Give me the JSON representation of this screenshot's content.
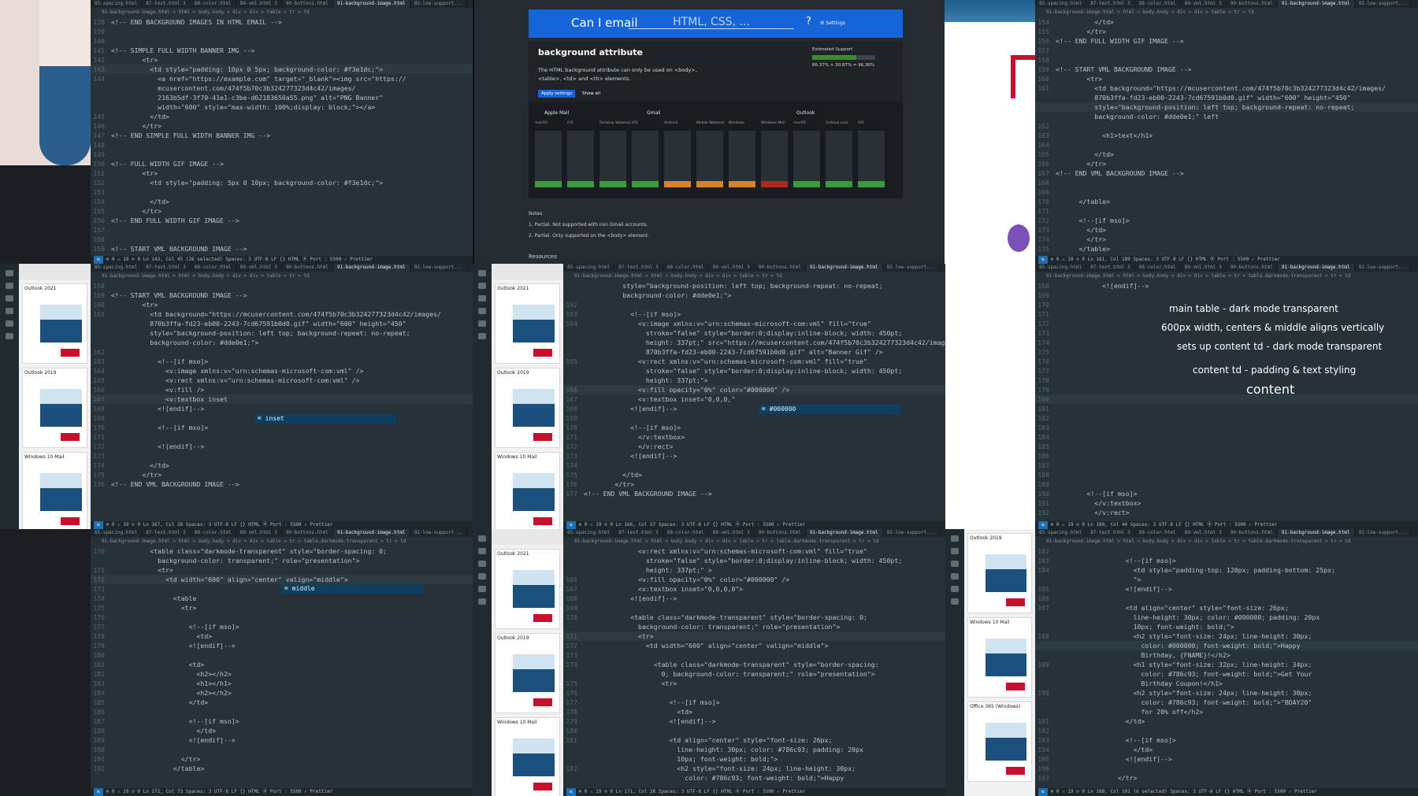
{
  "tabs": [
    "85-spacing.html",
    "87-text.html 3",
    "88-color.html",
    "89-vml.html 3",
    "90-buttons.html",
    "91-background-image.html",
    "92-low-support..."
  ],
  "crumb": "91-background-image.html > html > body.body > div > div > table > tr > td",
  "crumb_dark": "91-background-image.html > html > body.body > div > div > table > tr > table.darkmode-transparent > tr > td",
  "status_common": "⊗ 0 ⚠ 19   ⊘ 0",
  "status_right": "Spaces: 3   UTF-8   LF   {} HTML   ⦿ Port : 5500   ✓ Prettier",
  "pane1": {
    "lines": [
      {
        "n": "138",
        "t": "<!-- END BACKGROUND IMAGES IN HTML EMAIL -->"
      },
      {
        "n": "139",
        "t": ""
      },
      {
        "n": "140",
        "t": ""
      },
      {
        "n": "141",
        "t": "<!-- SIMPLE FULL WIDTH BANNER IMG -->"
      },
      {
        "n": "142",
        "t": "        <tr>"
      },
      {
        "n": "143",
        "t": "          <td style=\"padding: 10px 0 5px; background-color: #f3e1dc;\">",
        "hl": true
      },
      {
        "n": "144",
        "t": "            <a href=\"https://example.com\" target=\"_blank\"><img src=\"https://"
      },
      {
        "n": "",
        "t": "            mcusercontent.com/474f5b70c3b324277323d4c42/images/"
      },
      {
        "n": "",
        "t": "            2163b5df-3f70-41e1-c3be-d62183650a55.png\" alt=\"PNG Banner\""
      },
      {
        "n": "",
        "t": "            width=\"600\" style=\"max-width: 100%;display: block;\"></a>"
      },
      {
        "n": "145",
        "t": "          </td>"
      },
      {
        "n": "146",
        "t": "        </tr>"
      },
      {
        "n": "147",
        "t": "<!-- END SIMPLE FULL WIDTH BANNER IMG -->"
      },
      {
        "n": "148",
        "t": ""
      },
      {
        "n": "149",
        "t": ""
      },
      {
        "n": "150",
        "t": "<!-- FULL WIDTH GIF IMAGE -->"
      },
      {
        "n": "151",
        "t": "        <tr>"
      },
      {
        "n": "152",
        "t": "          <td style=\"padding: 5px 0 10px; background-color: #f3e1dc;\">"
      },
      {
        "n": "153",
        "t": ""
      },
      {
        "n": "154",
        "t": "          </td>"
      },
      {
        "n": "155",
        "t": "        </tr>"
      },
      {
        "n": "156",
        "t": "<!-- END FULL WIDTH GIF IMAGE -->"
      },
      {
        "n": "157",
        "t": ""
      },
      {
        "n": "158",
        "t": ""
      },
      {
        "n": "159",
        "t": "<!-- START VML BACKGROUND IMAGE -->"
      }
    ],
    "status": "Ln 143, Col 45 (26 selected)"
  },
  "pane2": {
    "lines": [
      {
        "n": "154",
        "t": "          </td>"
      },
      {
        "n": "155",
        "t": "        </tr>"
      },
      {
        "n": "156",
        "t": "<!-- END FULL WIDTH GIF IMAGE -->"
      },
      {
        "n": "157",
        "t": ""
      },
      {
        "n": "158",
        "t": ""
      },
      {
        "n": "159",
        "t": "<!-- START VML BACKGROUND IMAGE -->"
      },
      {
        "n": "160",
        "t": "        <tr>"
      },
      {
        "n": "161",
        "t": "          <td background=\"https://mcusercontent.com/474f5b70c3b324277323d4c42/images/"
      },
      {
        "n": "",
        "t": "          870b3ffa-fd23-eb00-2243-7cd67591b0d0.gif\" width=\"600\" height=\"450\""
      },
      {
        "n": "",
        "t": "          style=\"background-position: left top; background-repeat: no-repeat;",
        "hl": true
      },
      {
        "n": "",
        "t": "          background-color: #dde0e1;\" left"
      },
      {
        "n": "162",
        "t": ""
      },
      {
        "n": "163",
        "t": "            <h1>text</h1>"
      },
      {
        "n": "164",
        "t": ""
      },
      {
        "n": "165",
        "t": "          </td>"
      },
      {
        "n": "166",
        "t": "        </tr>"
      },
      {
        "n": "167",
        "t": "<!-- END VML BACKGROUND IMAGE -->"
      },
      {
        "n": "168",
        "t": ""
      },
      {
        "n": "169",
        "t": ""
      },
      {
        "n": "170",
        "t": "      </table>"
      },
      {
        "n": "171",
        "t": ""
      },
      {
        "n": "172",
        "t": "      <!--[if mso]>"
      },
      {
        "n": "173",
        "t": "        </td>"
      },
      {
        "n": "174",
        "t": "        </tr>"
      },
      {
        "n": "175",
        "t": "      </table>"
      }
    ],
    "status": "Ln 161, Col 189"
  },
  "pane3": {
    "lines": [
      {
        "n": "158",
        "t": ""
      },
      {
        "n": "159",
        "t": "<!-- START VML BACKGROUND IMAGE -->"
      },
      {
        "n": "160",
        "t": "        <tr>"
      },
      {
        "n": "161",
        "t": "          <td background=\"https://mcusercontent.com/474f5b70c3b324277323d4c42/images/"
      },
      {
        "n": "",
        "t": "          870b3ffa-fd23-eb00-2243-7cd67591b0d0.gif\" width=\"600\" height=\"450\""
      },
      {
        "n": "",
        "t": "          style=\"background-position: left top; background-repeat: no-repeat;"
      },
      {
        "n": "",
        "t": "          background-color: #dde0e1;\">"
      },
      {
        "n": "162",
        "t": ""
      },
      {
        "n": "163",
        "t": "            <!--[if mso]>"
      },
      {
        "n": "164",
        "t": "              <v:image xmlns:v=\"urn:schemas-microsoft-com:vml\" />"
      },
      {
        "n": "165",
        "t": "              <v:rect xmlns:v=\"urn:schemas-microsoft-com:vml\" />"
      },
      {
        "n": "166",
        "t": "              <v:fill />"
      },
      {
        "n": "167",
        "t": "              <v:textbox inset",
        "hl": true
      },
      {
        "n": "168",
        "t": "            <![endif]-->"
      },
      {
        "n": "169",
        "t": ""
      },
      {
        "n": "170",
        "t": "            <!--[if mso]>"
      },
      {
        "n": "171",
        "t": ""
      },
      {
        "n": "172",
        "t": "            <![endif]-->"
      },
      {
        "n": "173",
        "t": ""
      },
      {
        "n": "174",
        "t": "          </td>"
      },
      {
        "n": "175",
        "t": "        </tr>"
      },
      {
        "n": "176",
        "t": "<!-- END VML BACKGROUND IMAGE -->"
      }
    ],
    "suggest": "inset",
    "status": "Ln 167, Col 28"
  },
  "pane4": {
    "lines": [
      {
        "n": "",
        "t": "          style=\"background-position: left top; background-repeat: no-repeat;"
      },
      {
        "n": "",
        "t": "          background-color: #dde0e1;\">"
      },
      {
        "n": "162",
        "t": ""
      },
      {
        "n": "163",
        "t": "            <!--[if mso]>"
      },
      {
        "n": "164",
        "t": "              <v:image xmlns:v=\"urn:schemas-microsoft-com:vml\" fill=\"true\""
      },
      {
        "n": "",
        "t": "                stroke=\"false\" style=\"border:0;display:inline-block; width: 450pt;"
      },
      {
        "n": "",
        "t": "                height: 337pt;\" src=\"https://mcusercontent.com/474f5b70c3b324277323d4c42/images/"
      },
      {
        "n": "",
        "t": "                870b3ffa-fd23-eb00-2243-7cd67591b0d0.gif\" alt=\"Banner Gif\" />"
      },
      {
        "n": "165",
        "t": "              <v:rect xmlns:v=\"urn:schemas-microsoft-com:vml\" fill=\"true\""
      },
      {
        "n": "",
        "t": "                stroke=\"false\" style=\"border:0;display:inline-block; width: 450pt;"
      },
      {
        "n": "",
        "t": "                height: 337pt;\">"
      },
      {
        "n": "166",
        "t": "              <v:fill opacity=\"0%\" color=\"#000000\" />",
        "hl": true
      },
      {
        "n": "167",
        "t": "              <v:textbox inset=\"0,0,0,\""
      },
      {
        "n": "168",
        "t": "            <![endif]-->"
      },
      {
        "n": "169",
        "t": ""
      },
      {
        "n": "170",
        "t": "            <!--[if mso]>"
      },
      {
        "n": "171",
        "t": "              </v:textbox>"
      },
      {
        "n": "172",
        "t": "              </v:rect>"
      },
      {
        "n": "173",
        "t": "            <![endif]-->"
      },
      {
        "n": "174",
        "t": ""
      },
      {
        "n": "175",
        "t": "          </td>"
      },
      {
        "n": "176",
        "t": "        </tr>"
      },
      {
        "n": "177",
        "t": "<!-- END VML BACKGROUND IMAGE -->"
      }
    ],
    "suggest": "#000000",
    "status": "Ln 166, Col 57"
  },
  "pane5": {
    "lines": [
      {
        "n": "168",
        "t": "            <![endif]-->"
      },
      {
        "n": "169",
        "t": ""
      },
      {
        "n": "170",
        "t": ""
      },
      {
        "n": "171",
        "t": ""
      },
      {
        "n": "172",
        "t": ""
      },
      {
        "n": "173",
        "t": ""
      },
      {
        "n": "174",
        "t": ""
      },
      {
        "n": "175",
        "t": ""
      },
      {
        "n": "176",
        "t": ""
      },
      {
        "n": "177",
        "t": ""
      },
      {
        "n": "178",
        "t": ""
      },
      {
        "n": "179",
        "t": ""
      },
      {
        "n": "180",
        "t": "",
        "hl": true
      },
      {
        "n": "181",
        "t": ""
      },
      {
        "n": "182",
        "t": ""
      },
      {
        "n": "183",
        "t": ""
      },
      {
        "n": "184",
        "t": ""
      },
      {
        "n": "185",
        "t": ""
      },
      {
        "n": "186",
        "t": ""
      },
      {
        "n": "187",
        "t": ""
      },
      {
        "n": "188",
        "t": ""
      },
      {
        "n": "189",
        "t": ""
      },
      {
        "n": "190",
        "t": "        <!--[if mso]>"
      },
      {
        "n": "191",
        "t": "          </v:textbox>"
      },
      {
        "n": "192",
        "t": "          </v:rect>"
      }
    ],
    "annotations": [
      "main table - dark mode transparent",
      "600px width, centers & middle aligns vertically",
      "sets up content td - dark mode transparent",
      "content td - padding & text styling",
      "content"
    ],
    "status": "Ln 180, Col 44"
  },
  "pane6": {
    "lines": [
      {
        "n": "170",
        "t": "          <table class=\"darkmode-transparent\" style=\"border-spacing: 0;"
      },
      {
        "n": "",
        "t": "            background-color: transparent;\" role=\"presentation\">"
      },
      {
        "n": "171",
        "t": "            <tr>"
      },
      {
        "n": "172",
        "t": "              <td width=\"600\" align=\"center\" valign=\"middle\">",
        "hl": true
      },
      {
        "n": "173",
        "t": ""
      },
      {
        "n": "174",
        "t": "                <table"
      },
      {
        "n": "175",
        "t": "                  <tr>"
      },
      {
        "n": "176",
        "t": ""
      },
      {
        "n": "177",
        "t": "                    <!--[if mso]>"
      },
      {
        "n": "178",
        "t": "                      <td>"
      },
      {
        "n": "179",
        "t": "                    <![endif]-->"
      },
      {
        "n": "180",
        "t": ""
      },
      {
        "n": "181",
        "t": "                    <td>"
      },
      {
        "n": "182",
        "t": "                      <h2></h2>"
      },
      {
        "n": "183",
        "t": "                      <h1></h1>"
      },
      {
        "n": "184",
        "t": "                      <h2></h2>"
      },
      {
        "n": "185",
        "t": "                    </td>"
      },
      {
        "n": "186",
        "t": ""
      },
      {
        "n": "187",
        "t": "                    <!--[if mso]>"
      },
      {
        "n": "188",
        "t": "                      </td>"
      },
      {
        "n": "189",
        "t": "                    <![endif]-->"
      },
      {
        "n": "190",
        "t": ""
      },
      {
        "n": "191",
        "t": "                  </tr>"
      },
      {
        "n": "192",
        "t": "                </table>"
      }
    ],
    "suggest": "middle",
    "status": "Ln 172, Col 73"
  },
  "pane7": {
    "lines": [
      {
        "n": "",
        "t": "              <v:rect xmlns:v=\"urn:schemas-microsoft-com:vml\" fill=\"true\""
      },
      {
        "n": "",
        "t": "                stroke=\"false\" style=\"border:0;display:inline-block; width: 450pt;"
      },
      {
        "n": "",
        "t": "                height: 337pt;\" >"
      },
      {
        "n": "166",
        "t": "              <v:fill opacity=\"0%\" color=\"#000000\" />"
      },
      {
        "n": "167",
        "t": "              <v:textbox inset=\"0,0,0,0\">"
      },
      {
        "n": "168",
        "t": "            <![endif]-->"
      },
      {
        "n": "169",
        "t": ""
      },
      {
        "n": "170",
        "t": "            <table class=\"darkmode-transparent\" style=\"border-spacing: 0;"
      },
      {
        "n": "",
        "t": "              background-color: transparent;\" role=\"presentation\">"
      },
      {
        "n": "171",
        "t": "              <tr>",
        "hl": true
      },
      {
        "n": "172",
        "t": "                <td width=\"600\" align=\"center\" valign=\"middle\">"
      },
      {
        "n": "173",
        "t": ""
      },
      {
        "n": "174",
        "t": "                  <table class=\"darkmode-transparent\" style=\"border-spacing:"
      },
      {
        "n": "",
        "t": "                    0; background-color: transparent;\" role=\"presentation\">"
      },
      {
        "n": "175",
        "t": "                    <tr>"
      },
      {
        "n": "176",
        "t": ""
      },
      {
        "n": "177",
        "t": "                      <!--[if mso]>"
      },
      {
        "n": "178",
        "t": "                        <td>"
      },
      {
        "n": "179",
        "t": "                      <![endif]-->"
      },
      {
        "n": "180",
        "t": ""
      },
      {
        "n": "181",
        "t": "                      <td align=\"center\" style=\"font-size: 26px;"
      },
      {
        "n": "",
        "t": "                        line-height: 30px; color: #786c93; padding: 20px"
      },
      {
        "n": "",
        "t": "                        10px; font-weight: bold;\">"
      },
      {
        "n": "182",
        "t": "                        <h2 style=\"font-size: 24px; line-height: 30px;"
      },
      {
        "n": "",
        "t": "                          color: #786c93; font-weight: bold;\">Happy"
      }
    ],
    "status": "Ln 171, Col 28"
  },
  "pane8": {
    "lines": [
      {
        "n": "182",
        "t": ""
      },
      {
        "n": "183",
        "t": "                  <!--[if mso]>"
      },
      {
        "n": "184",
        "t": "                    <td style=\"padding-top: 120px; padding-bottom: 25px;"
      },
      {
        "n": "",
        "t": "                    \">"
      },
      {
        "n": "185",
        "t": "                  <![endif]-->"
      },
      {
        "n": "186",
        "t": ""
      },
      {
        "n": "187",
        "t": "                  <td align=\"center\" style=\"font-size: 26px;"
      },
      {
        "n": "",
        "t": "                    line-height: 30px; color: #000000; padding: 20px"
      },
      {
        "n": "",
        "t": "                    10px; font-weight: bold;\">"
      },
      {
        "n": "188",
        "t": "                    <h2 style=\"font-size: 24px; line-height: 30px;"
      },
      {
        "n": "",
        "t": "                      color: #000000; font-weight: bold;\">Happy",
        "hl": true
      },
      {
        "n": "",
        "t": "                      Birthday, {FNAME}!</h2>"
      },
      {
        "n": "189",
        "t": "                    <h1 style=\"font-size: 32px; line-height: 34px;"
      },
      {
        "n": "",
        "t": "                      color: #786c93; font-weight: bold;\">Get Your"
      },
      {
        "n": "",
        "t": "                      Birthday Coupon!</h1>"
      },
      {
        "n": "190",
        "t": "                    <h2 style=\"font-size: 24px; line-height: 30px;"
      },
      {
        "n": "",
        "t": "                      color: #786c93; font-weight: bold;\">\"BDAY20\""
      },
      {
        "n": "",
        "t": "                      for 20% off</h2>"
      },
      {
        "n": "191",
        "t": "                  </td>"
      },
      {
        "n": "192",
        "t": ""
      },
      {
        "n": "193",
        "t": "                  <!--[if mso]>"
      },
      {
        "n": "194",
        "t": "                    </td>"
      },
      {
        "n": "195",
        "t": "                  <![endif]-->"
      },
      {
        "n": "196",
        "t": ""
      },
      {
        "n": "197",
        "t": "                </tr>"
      }
    ],
    "status": "Ln 188, Col 101 (6 selected)"
  },
  "caniemail": {
    "logo": "Can I email",
    "search_placeholder": "HTML, CSS, ...",
    "help": "?",
    "settings": "⚙ Settings",
    "heading": "background attribute",
    "description": "The HTML background attribute can only be used on <body>, <table>, <td> and <th> elements.",
    "support_label": "Estimated Support",
    "support_pct": "66.37% + 30.87% = 96.36%",
    "apply_btn": "Apply settings",
    "showall_btn": "Show all",
    "groups": [
      "Apple Mail",
      "Gmail",
      "Outlook"
    ],
    "clients": [
      "macOS",
      "iOS",
      "Desktop Webmail",
      "iOS",
      "Android",
      "Mobile Webmail",
      "Windows",
      "Windows Mail",
      "macOS",
      "Outlook.com",
      "iOS"
    ],
    "notes_title": "Notes",
    "notes": [
      "1. Partial. Not supported with non Gmail accounts.",
      "2. Partial. Only supported on the <body> element."
    ],
    "resources": "Resources"
  },
  "thumbnails": [
    "Outlook 2021",
    "Outlook 2019",
    "Windows 10 Mail"
  ],
  "thumbnails2": [
    "Outlook 2019",
    "Windows 10 Mail",
    "Office 365 (Windows)"
  ],
  "colors": {
    "editor_bg": "#263238",
    "statusbar": "#1d262b",
    "accent": "#1565d8"
  }
}
